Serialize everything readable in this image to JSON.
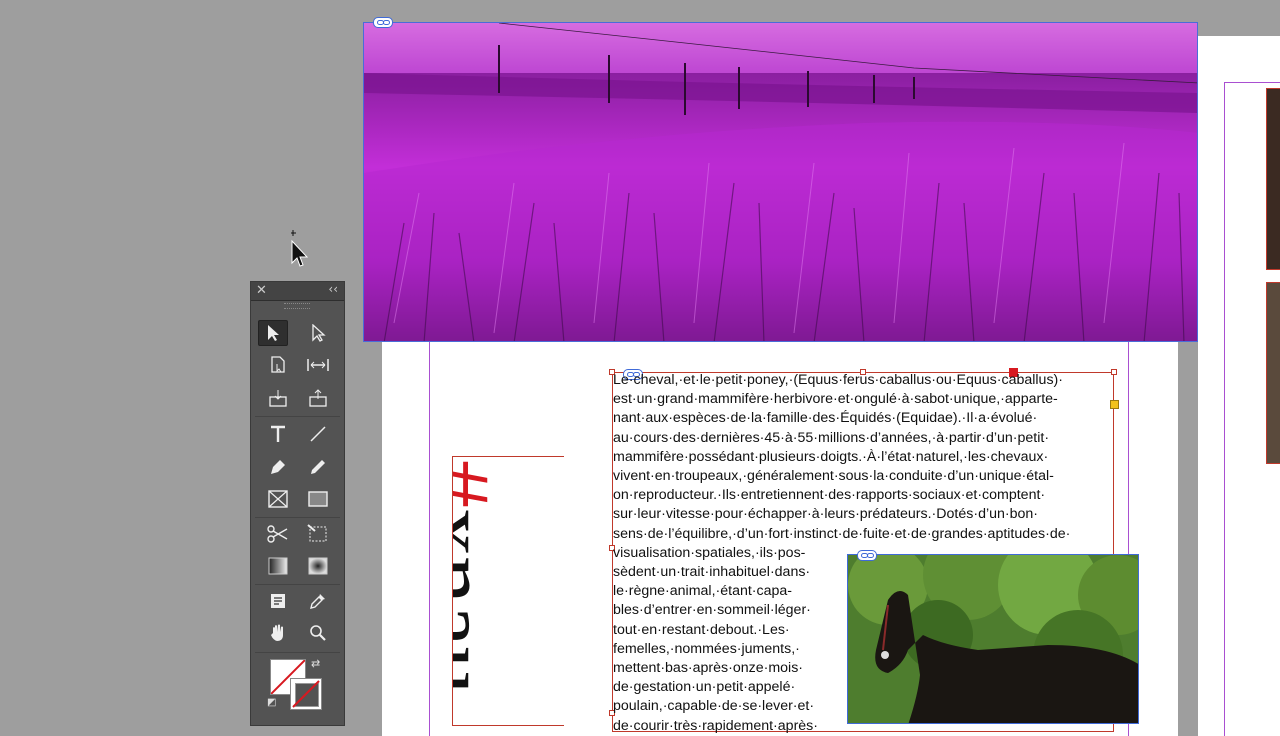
{
  "document": {
    "body_lines": [
      "Le·cheval,·et·le·petit·poney,·(Equus·ferus·caballus·ou·Equus·caballus)·",
      "est·un·grand·mammifère·herbivore·et·ongulé·à·sabot·unique,·apparte-",
      "nant·aux·espèces·de·la·famille·des·Équidés·(Equidae).·Il·a·évolué·",
      "au·cours·des·dernières·45·à·55·millions·d’années,·à·partir·d’un·petit·",
      "mammifère·possédant·plusieurs·doigts.·À·l’état·naturel,·les·chevaux·",
      "vivent·en·troupeaux,·généralement·sous·la·conduite·d’un·unique·étal-",
      "on·reproducteur.·Ils·entretiennent·des·rapports·sociaux·et·comptent·",
      "sur·leur·vitesse·pour·échapper·à·leurs·prédateurs.·Dotés·d’un·bon·",
      "sens·de·l’équilibre,·d’un·fort·instinct·de·fuite·et·de·grandes·aptitudes·de·",
      "visualisation·spatiales,·ils·pos-",
      "sèdent·un·trait·inhabituel·dans·",
      "le·règne·animal,·étant·capa-",
      "bles·d’entrer·en·sommeil·léger·",
      "tout·en·restant·debout.·Les·",
      "femelles,·nommées·juments,·",
      "mettent·bas·après·onze·mois·",
      "de·gestation·un·petit·appelé·",
      "poulain,·capable·de·se·lever·et·",
      "de·courir·très·rapidement·après·"
    ],
    "title": {
      "prefix": "#",
      "word": "xnau"
    }
  },
  "colors": {
    "hash_red": "#d71920",
    "frame_red": "#c0392b",
    "margin_purple": "#a94fd1",
    "link_blue": "#3f6ad8",
    "panel_gray": "#535353"
  },
  "tools": [
    "selection-tool-icon",
    "direct-selection-tool-icon",
    "page-tool-icon",
    "gap-tool-icon",
    "content-collector-icon",
    "content-placer-icon",
    "type-tool-icon",
    "line-tool-icon",
    "pen-tool-icon",
    "pencil-tool-icon",
    "rectangle-frame-tool-icon",
    "rectangle-tool-icon",
    "scissors-tool-icon",
    "free-transform-tool-icon",
    "gradient-swatch-tool-icon",
    "gradient-feather-tool-icon",
    "note-tool-icon",
    "eyedropper-tool-icon",
    "hand-tool-icon",
    "zoom-tool-icon"
  ]
}
